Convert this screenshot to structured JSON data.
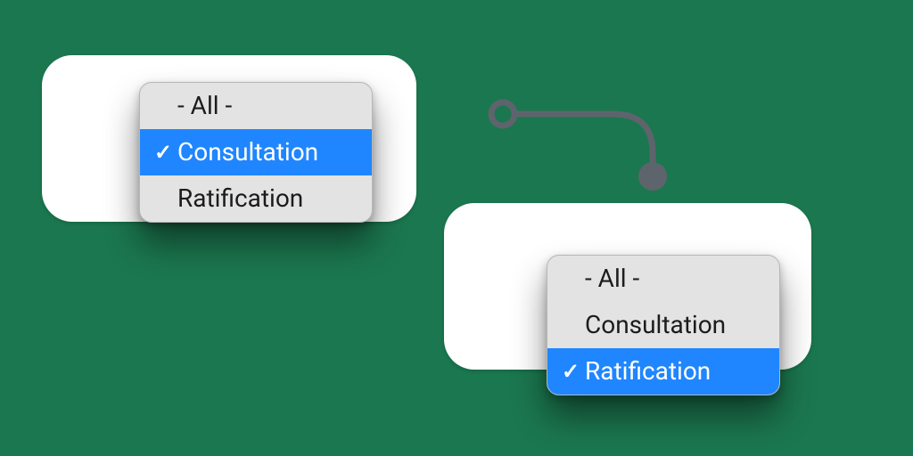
{
  "dropdowns": {
    "a": {
      "options": [
        {
          "label": "- All -",
          "selected": false
        },
        {
          "label": "Consultation",
          "selected": true
        },
        {
          "label": "Ratification",
          "selected": false
        }
      ]
    },
    "b": {
      "options": [
        {
          "label": "- All -",
          "selected": false
        },
        {
          "label": "Consultation",
          "selected": false
        },
        {
          "label": "Ratification",
          "selected": true
        }
      ]
    }
  },
  "glyphs": {
    "check": "✓"
  },
  "colors": {
    "bg": "#1b774f",
    "highlight": "#1f86ff",
    "connector": "#5e646c"
  }
}
